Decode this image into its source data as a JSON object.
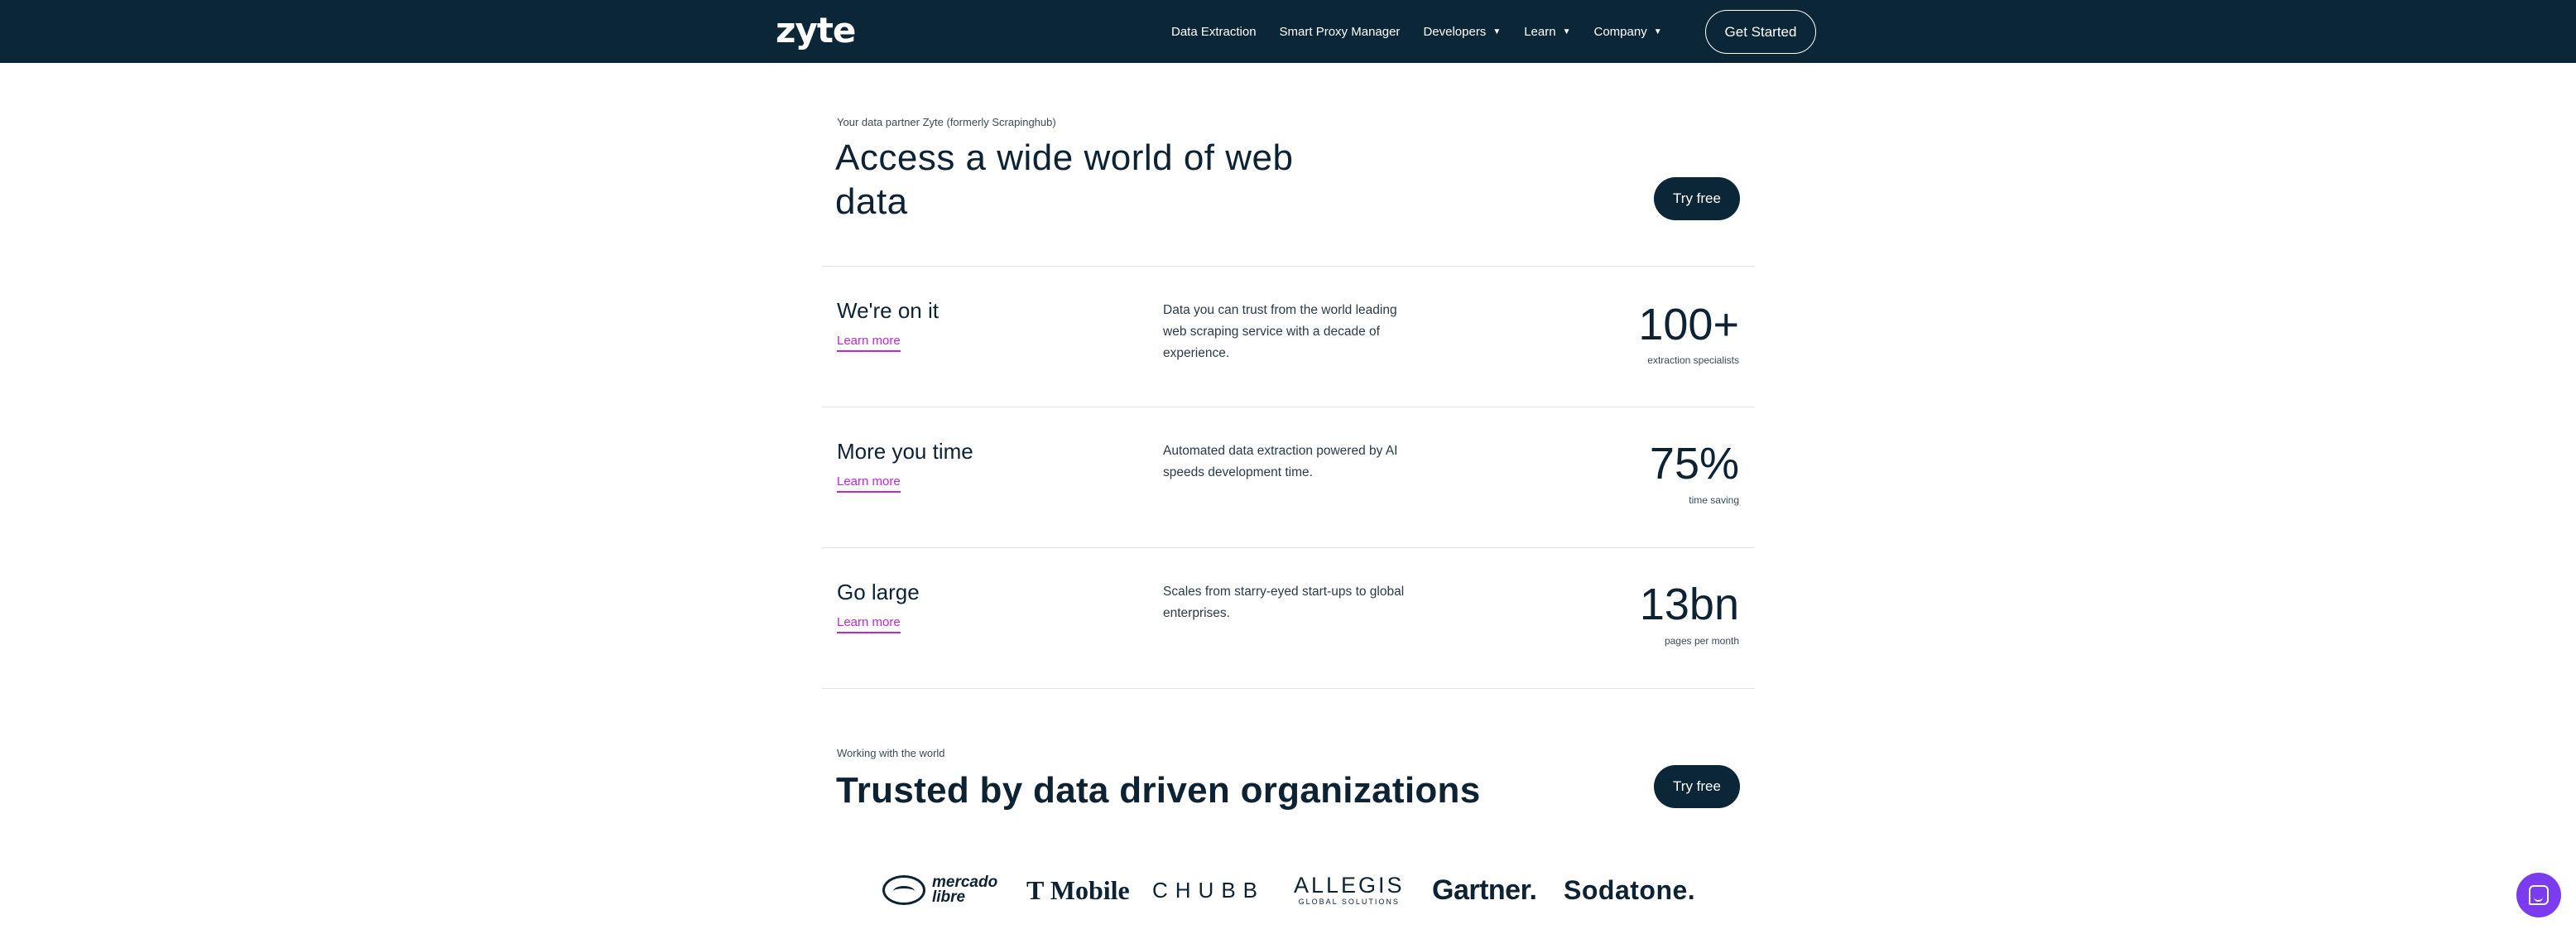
{
  "nav": {
    "logo": "zyte",
    "links": [
      {
        "label": "Data Extraction",
        "dropdown": false
      },
      {
        "label": "Smart Proxy Manager",
        "dropdown": false
      },
      {
        "label": "Developers",
        "dropdown": true
      },
      {
        "label": "Learn",
        "dropdown": true
      },
      {
        "label": "Company",
        "dropdown": true
      }
    ],
    "cta": "Get Started",
    "caret": "▼"
  },
  "hero": {
    "eyebrow": "Your data partner Zyte (formerly Scrapinghub)",
    "title": "Access a wide world of web data",
    "cta": "Try free"
  },
  "features": [
    {
      "title": "We're on it",
      "link": "Learn more",
      "description": "Data you can trust from the world leading web scraping service with a decade of experience.",
      "stat": "100+",
      "stat_label": "extraction specialists"
    },
    {
      "title": "More you time",
      "link": "Learn more",
      "description": "Automated data extraction powered by AI speeds development time.",
      "stat": "75%",
      "stat_label": "time saving"
    },
    {
      "title": "Go large",
      "link": "Learn more",
      "description": "Scales from starry-eyed start-ups to global enterprises.",
      "stat": "13bn",
      "stat_label": "pages per month"
    }
  ],
  "trusted": {
    "eyebrow": "Working with the world",
    "title": "Trusted by data driven organizations",
    "cta": "Try free"
  },
  "brands": {
    "mercado_line1": "mercado",
    "mercado_line2": "libre",
    "tmobile": "T Mobile",
    "chubb": "CHUBB",
    "allegis_line1": "ALLEGIS",
    "allegis_line2": "GLOBAL SOLUTIONS",
    "gartner": "Gartner.",
    "sodatone": "Sodatone."
  },
  "colors": {
    "nav_bg": "#0b2636",
    "link_accent": "#c026d3",
    "chat_bg": "#7b3bef"
  }
}
